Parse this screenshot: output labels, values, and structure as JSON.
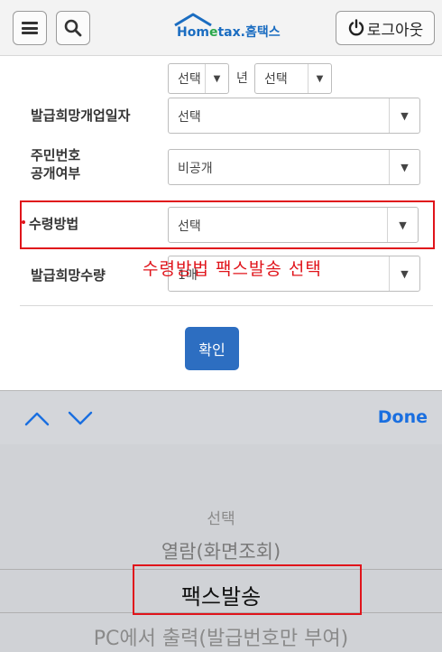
{
  "header": {
    "menu_icon": "hamburger-menu-icon",
    "search_icon": "search-icon",
    "logo_text_main": "Hom",
    "logo_text_mid": "e",
    "logo_text_tax": "tax.",
    "logo_text_kr": "홈택스",
    "logout_icon": "power-icon",
    "logout_label": "로그아웃",
    "brand_color": "#1b6dc1"
  },
  "form": {
    "top_row": {
      "select1": "선택",
      "year_label": "년",
      "select2": "선택"
    },
    "rows": [
      {
        "label": "발급희망개업일자",
        "value": "선택"
      },
      {
        "label_line1": "주민번호",
        "label_line2": "공개여부",
        "value": "비공개"
      },
      {
        "label": "수령방법",
        "value": "선택"
      },
      {
        "label": "발급희망수량",
        "value": "1매"
      }
    ],
    "annotation": "수령방법 팩스발송 선택",
    "confirm_label": "확인",
    "accent_color": "#2d6ec1",
    "highlight_color": "#e0141b"
  },
  "toolbar": {
    "up_icon": "chevron-up-icon",
    "down_icon": "chevron-down-icon",
    "done_label": "Done",
    "done_color": "#1a6fe0"
  },
  "picker": {
    "options": [
      "선택",
      "열람(화면조회)",
      "팩스발송",
      "PC에서 출력(발급번호만 부여)"
    ],
    "selected": "팩스발송"
  }
}
